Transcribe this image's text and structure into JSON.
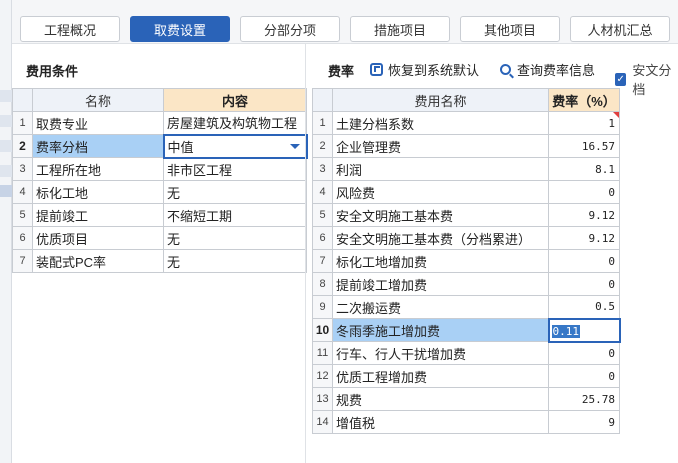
{
  "tabs": [
    {
      "label": "工程概况",
      "active": false
    },
    {
      "label": "取费设置",
      "active": true
    },
    {
      "label": "分部分项",
      "active": false
    },
    {
      "label": "措施项目",
      "active": false
    },
    {
      "label": "其他项目",
      "active": false
    },
    {
      "label": "人材机汇总",
      "active": false
    }
  ],
  "left_panel": {
    "title": "费用条件",
    "headers": {
      "name": "名称",
      "content": "内容"
    },
    "rows": [
      {
        "idx": "1",
        "name": "取费专业",
        "content": "房屋建筑及构筑物工程"
      },
      {
        "idx": "2",
        "name": "费率分档",
        "content": "中值"
      },
      {
        "idx": "3",
        "name": "工程所在地",
        "content": "非市区工程"
      },
      {
        "idx": "4",
        "name": "标化工地",
        "content": "无"
      },
      {
        "idx": "5",
        "name": "提前竣工",
        "content": "不缩短工期"
      },
      {
        "idx": "6",
        "name": "优质项目",
        "content": "无"
      },
      {
        "idx": "7",
        "name": "装配式PC率",
        "content": "无"
      }
    ]
  },
  "right_panel": {
    "title": "费率",
    "restore_label": "恢复到系统默认",
    "query_label": "查询费率信息",
    "safety_label": "安文分档",
    "safety_checked": true,
    "headers": {
      "name": "费用名称",
      "rate": "费率（%）"
    },
    "rows": [
      {
        "idx": "1",
        "name": "土建分档系数",
        "rate": "1"
      },
      {
        "idx": "2",
        "name": "企业管理费",
        "rate": "16.57"
      },
      {
        "idx": "3",
        "name": "利润",
        "rate": "8.1"
      },
      {
        "idx": "4",
        "name": "风险费",
        "rate": "0"
      },
      {
        "idx": "5",
        "name": "安全文明施工基本费",
        "rate": "9.12"
      },
      {
        "idx": "6",
        "name": "安全文明施工基本费（分档累进）",
        "rate": "9.12"
      },
      {
        "idx": "7",
        "name": "标化工地增加费",
        "rate": "0"
      },
      {
        "idx": "8",
        "name": "提前竣工增加费",
        "rate": "0"
      },
      {
        "idx": "9",
        "name": "二次搬运费",
        "rate": "0.5"
      },
      {
        "idx": "10",
        "name": "冬雨季施工增加费",
        "rate": "0.11"
      },
      {
        "idx": "11",
        "name": "行车、行人干扰增加费",
        "rate": "0"
      },
      {
        "idx": "12",
        "name": "优质工程增加费",
        "rate": "0"
      },
      {
        "idx": "13",
        "name": "规费",
        "rate": "25.78"
      },
      {
        "idx": "14",
        "name": "增值税",
        "rate": "9"
      }
    ]
  },
  "colors": {
    "accent": "#2a63b8",
    "header_highlight": "#fbe6c6",
    "selected_cell": "#a9d0f5",
    "flag": "#e04040"
  }
}
